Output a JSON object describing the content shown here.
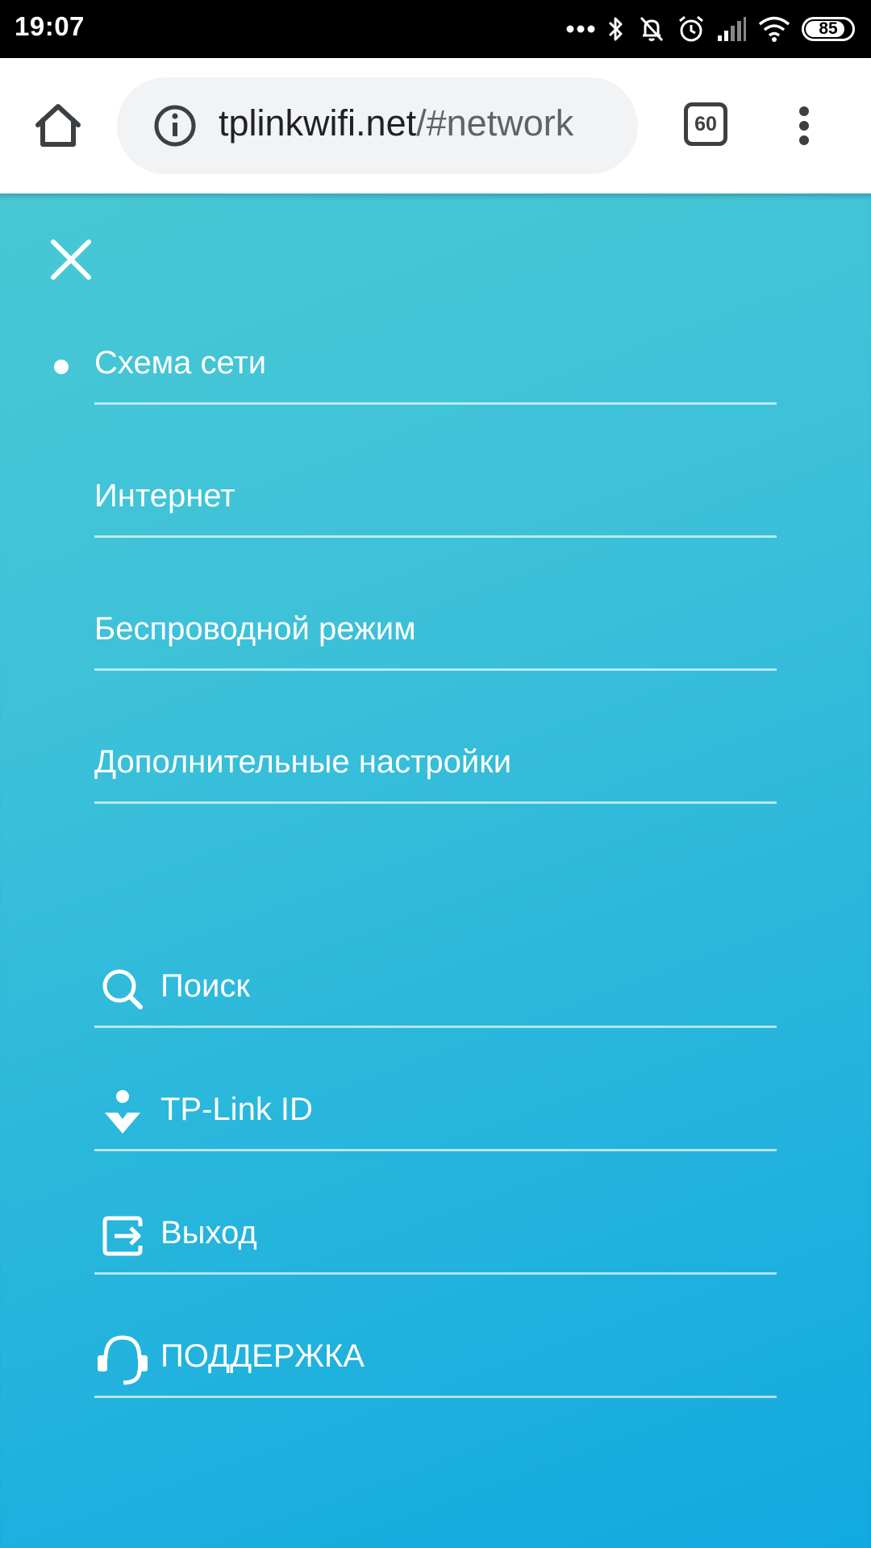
{
  "status_bar": {
    "time": "19:07",
    "battery_level": 85,
    "battery_label": "85",
    "icons": [
      "more-notifications-icon",
      "bluetooth-icon",
      "silent-mode-icon",
      "alarm-icon",
      "signal-icon",
      "wifi-icon",
      "battery-icon"
    ]
  },
  "browser": {
    "url_host": "tplinkwifi.net",
    "url_path": "/#network",
    "tab_count": "60",
    "icons": [
      "home-icon",
      "info-icon",
      "tab-switcher-icon",
      "more-vert-icon"
    ]
  },
  "menu": {
    "colors": {
      "gradient_start": "#48c8d5",
      "gradient_end": "#12a9df",
      "text": "#ffffff"
    },
    "nav_items": [
      {
        "label": "Схема сети",
        "active": true
      },
      {
        "label": "Интернет",
        "active": false
      },
      {
        "label": "Беспроводной режим",
        "active": false
      },
      {
        "label": "Дополнительные настройки",
        "active": false
      }
    ],
    "tool_items": [
      {
        "label": "Поиск",
        "icon": "search-icon"
      },
      {
        "label": "TP-Link ID",
        "icon": "tp-link-id-icon"
      },
      {
        "label": "Выход",
        "icon": "logout-icon"
      },
      {
        "label": "ПОДДЕРЖКА",
        "icon": "support-headset-icon"
      }
    ]
  }
}
